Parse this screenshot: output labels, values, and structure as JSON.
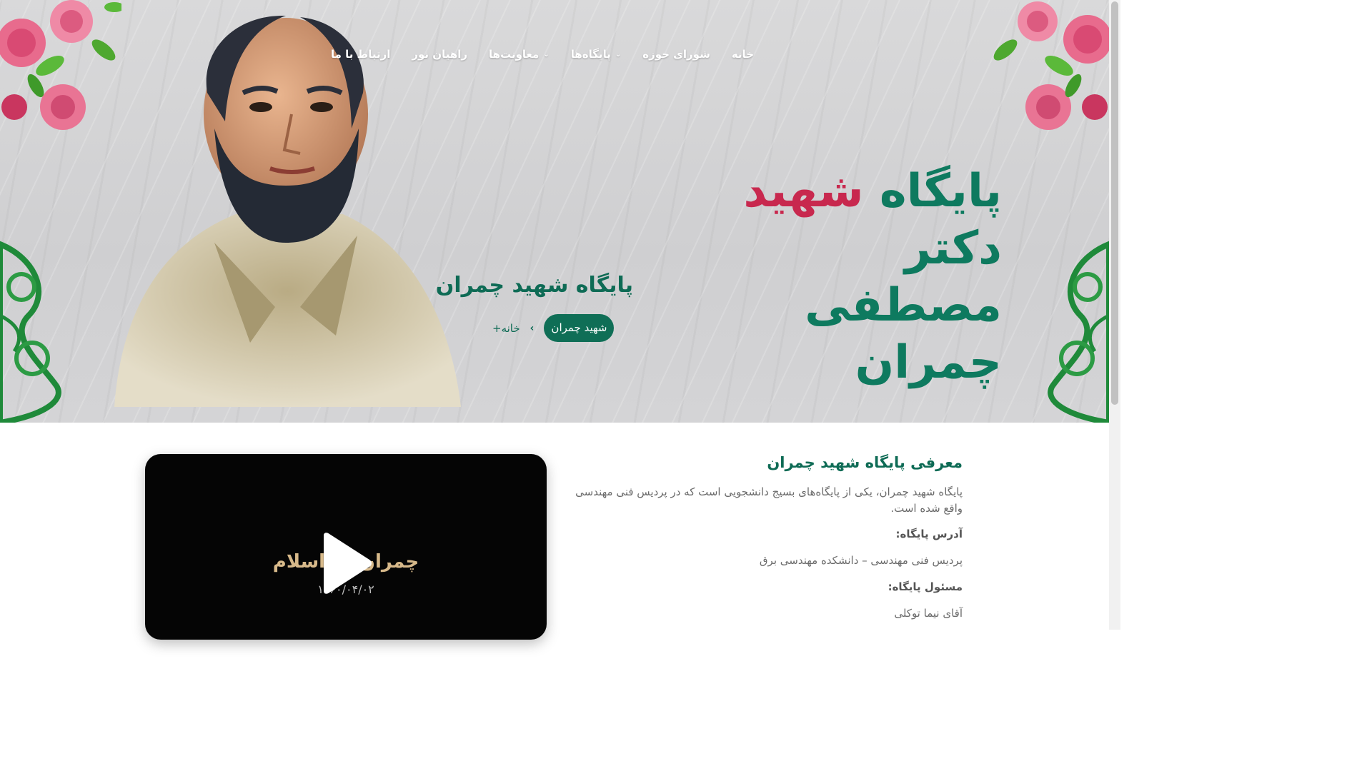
{
  "nav": {
    "items": [
      {
        "label": "خانه",
        "has_dropdown": false
      },
      {
        "label": "شورای حوزه",
        "has_dropdown": false
      },
      {
        "label": "پایگاه‌ها",
        "has_dropdown": true
      },
      {
        "label": "معاونت‌ها",
        "has_dropdown": true
      },
      {
        "label": "راهیان نور",
        "has_dropdown": false
      },
      {
        "label": "ارتباط با ما",
        "has_dropdown": false
      }
    ]
  },
  "hero": {
    "title_line1_part1": "پایگاه ",
    "title_line1_accent": "شهید",
    "title_line1_part2": " دکتر",
    "title_line2": "مصطفی چمران",
    "page_title": "پایگاه شهید چمران",
    "breadcrumb": {
      "home": "خانه+",
      "separator": "›",
      "current": "شهید چمران"
    }
  },
  "video": {
    "caption": "چمران ... اسلام",
    "date": "۱۳۶۰/۰۴/۰۲"
  },
  "about": {
    "title": "معرفی پایگاه شهید چمران",
    "description": "پایگاه شهید چمران، یکی از پایگاه‌های بسیج دانشجویی است که در پردیس فنی مهندسی واقع شده است.",
    "address_label": "آدرس پایگاه:",
    "address_value": "پردیس فنی مهندسی – دانشکده مهندسی برق",
    "manager_label": "مسئول پایگاه:",
    "manager_value": "آقای نیما توکلی"
  },
  "colors": {
    "brand_green": "#0e6b55",
    "accent_red": "#c8284e",
    "hero_bg": "#d4d4d6"
  }
}
